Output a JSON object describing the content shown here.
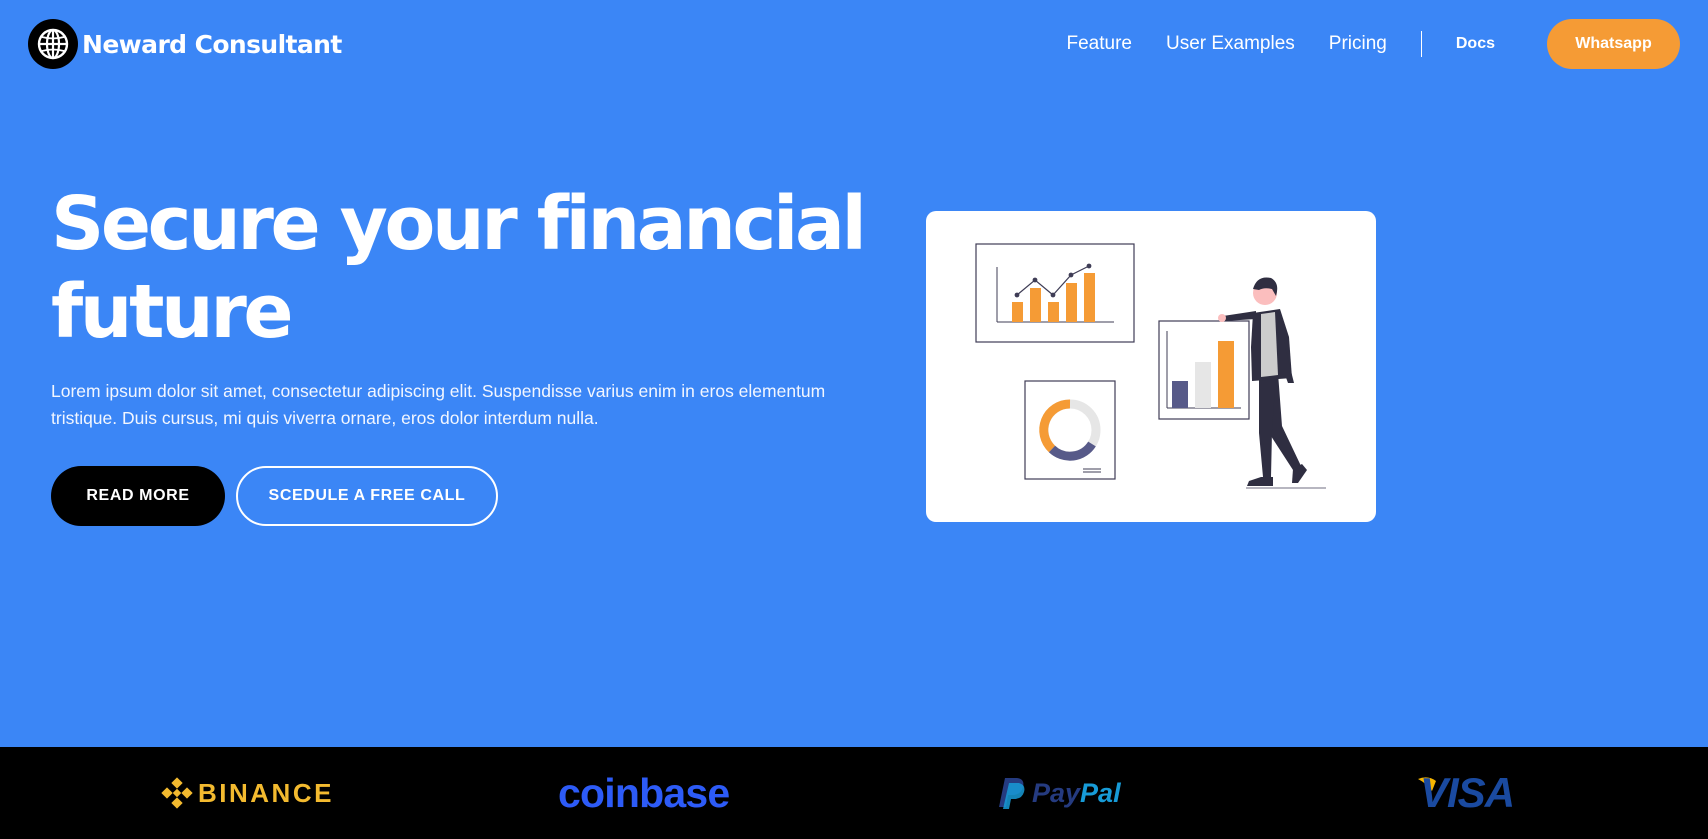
{
  "brand": {
    "name": "Neward Consultant",
    "logo_icon": "globe-icon"
  },
  "nav": {
    "links": [
      "Feature",
      "User Examples",
      "Pricing"
    ],
    "docs": "Docs",
    "cta": "Whatsapp"
  },
  "hero": {
    "title_line1": "Secure your financial",
    "title_line2": "future",
    "description": "Lorem ipsum dolor sit amet, consectetur adipiscing elit. Suspendisse varius enim in eros elementum tristique. Duis cursus, mi quis viverra ornare, eros dolor interdum nulla.",
    "primary_button": "READ MORE",
    "secondary_button": "SCEDULE A FREE CALL",
    "illustration": "financial-analytics-illustration"
  },
  "partners": {
    "binance": "BINANCE",
    "coinbase": "coinbase",
    "paypal_pay": "Pay",
    "paypal_pal": "Pal",
    "visa": "VISA"
  },
  "colors": {
    "background": "#3b86f6",
    "accent": "#f59b35",
    "dark": "#000000",
    "binance": "#f3ba2f",
    "coinbase": "#2d5bf7",
    "paypal_dark": "#253b80",
    "paypal_light": "#179bd7",
    "visa": "#1a4aa0"
  }
}
